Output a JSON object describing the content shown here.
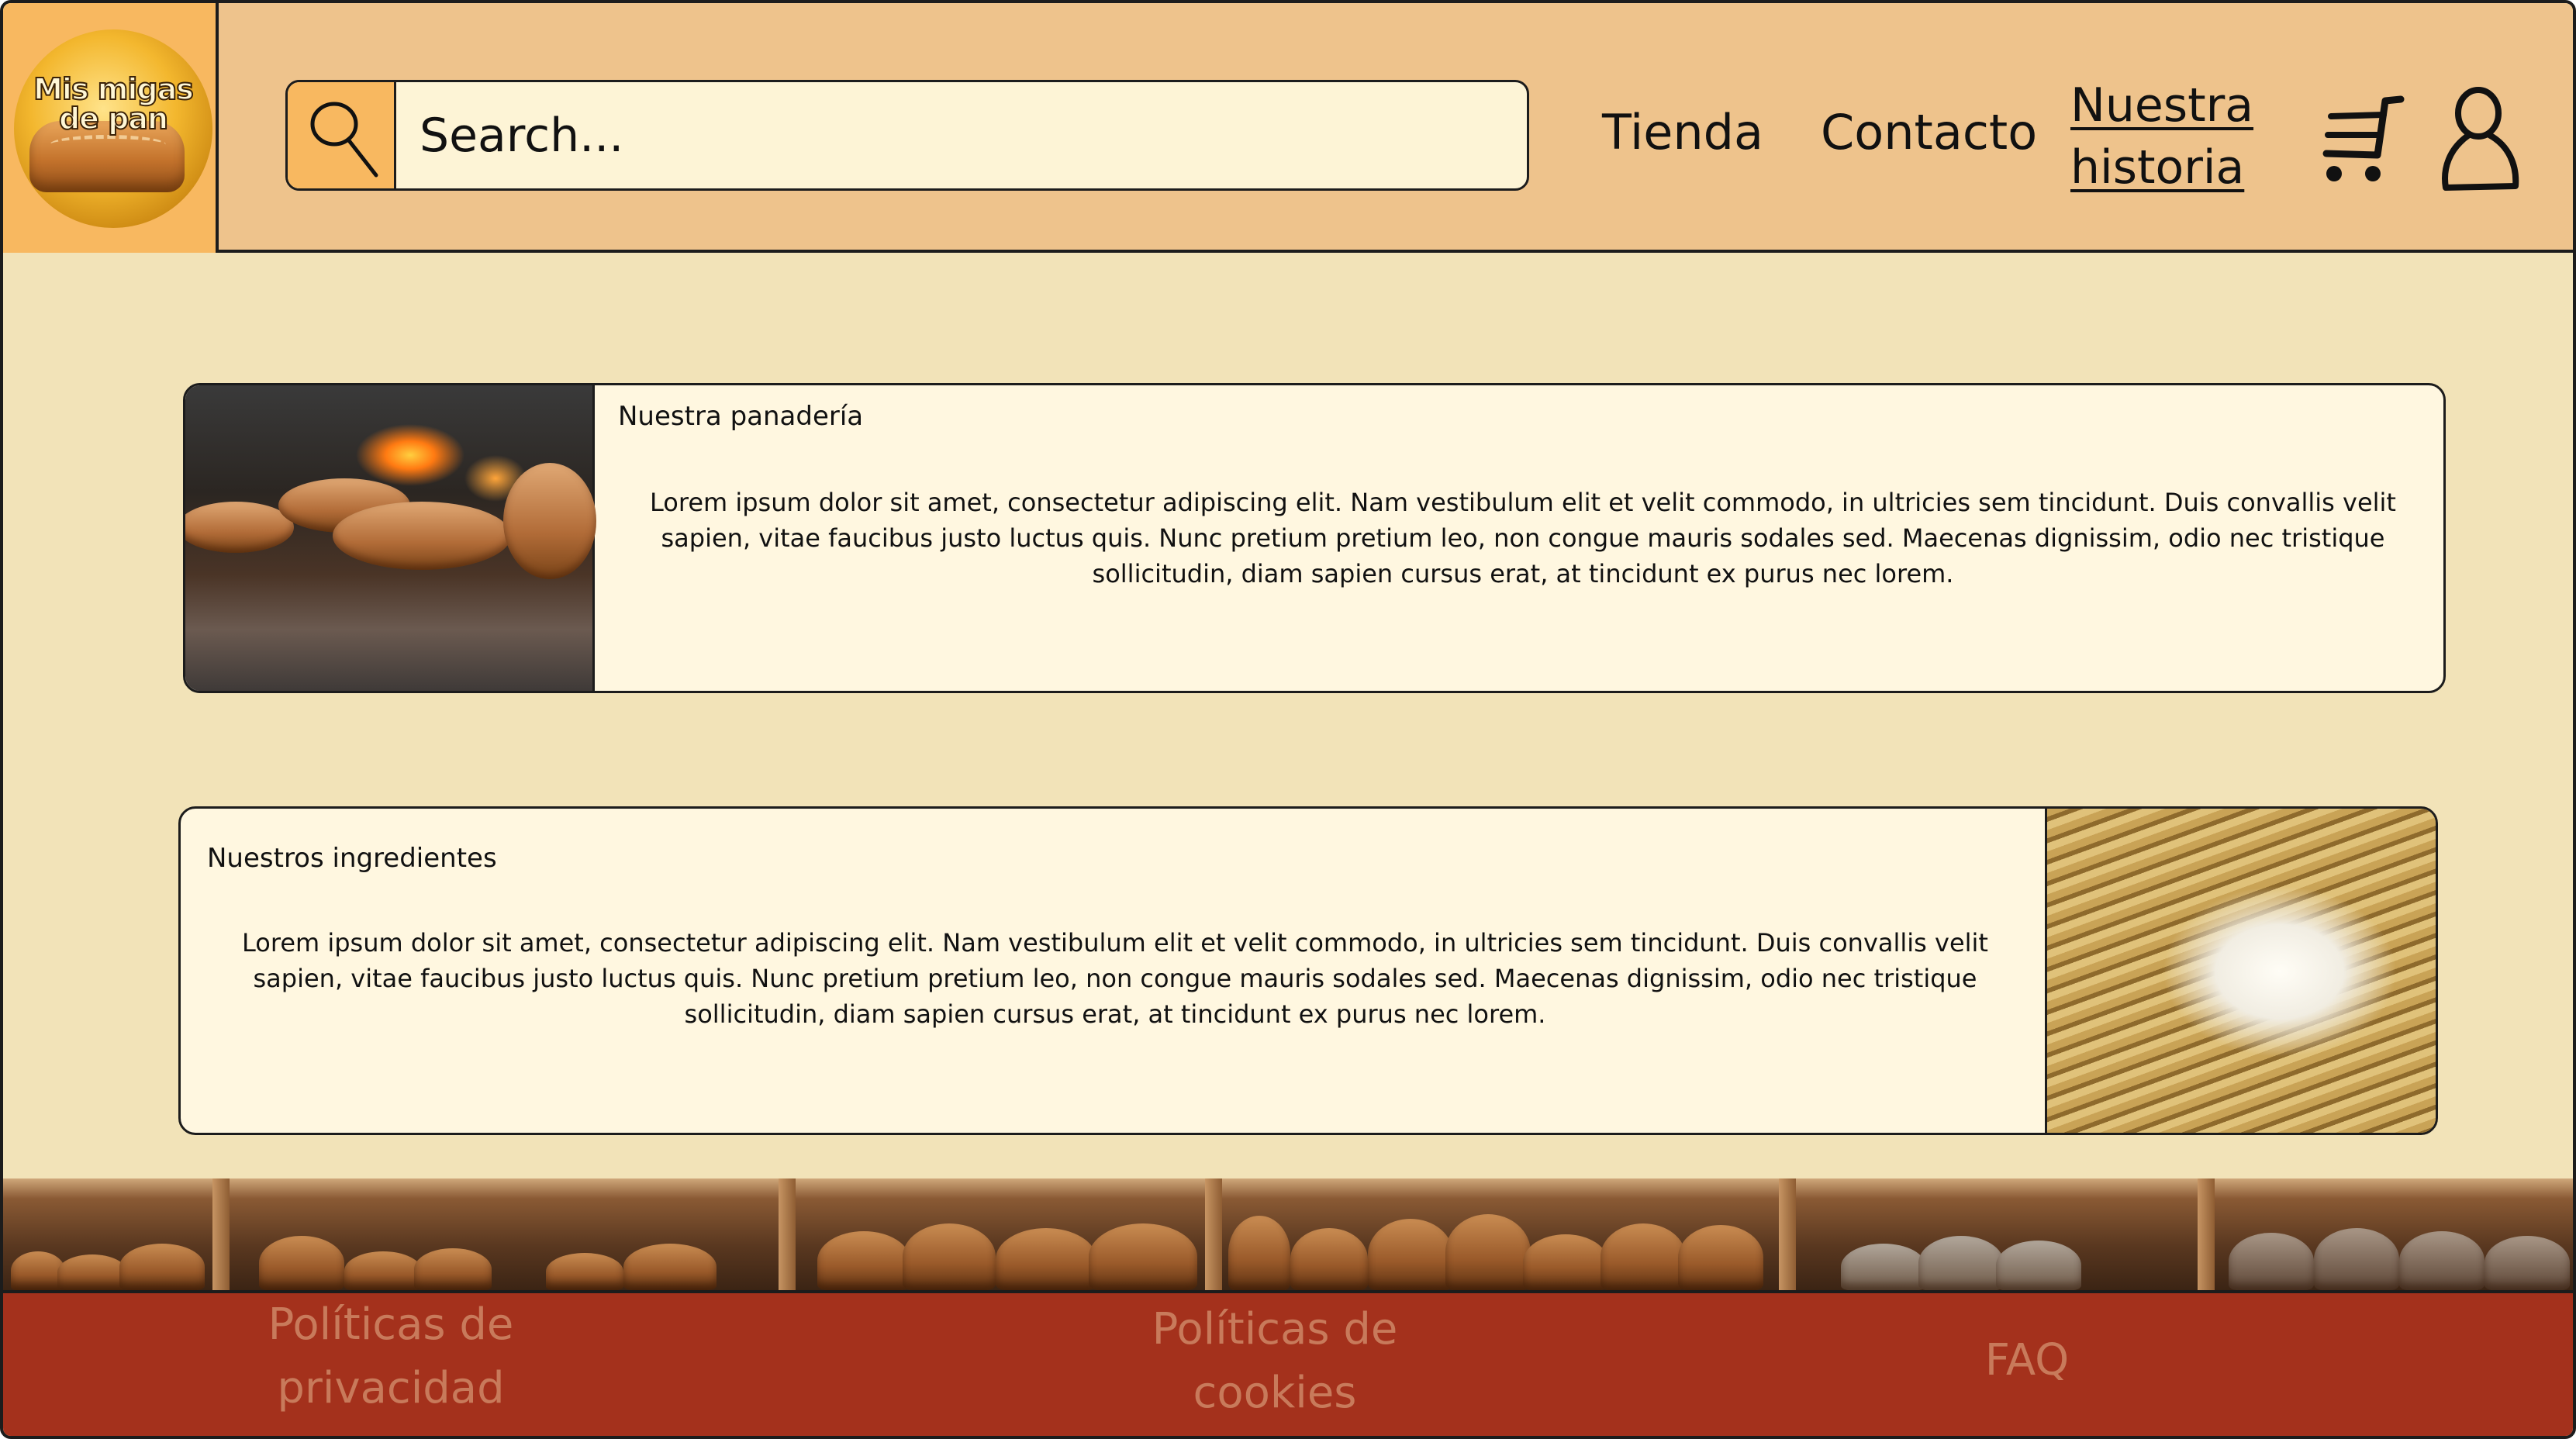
{
  "logo": {
    "text": "Mis migas de pan"
  },
  "search": {
    "placeholder": "Search...",
    "value": ""
  },
  "nav": {
    "shop": "Tienda",
    "contact": "Contacto",
    "history": "Nuestra historia"
  },
  "icons": {
    "search": "search-icon",
    "cart": "cart-icon",
    "user": "user-icon"
  },
  "sections": [
    {
      "title": "Nuestra panadería",
      "body": "Lorem ipsum dolor sit amet, consectetur adipiscing elit. Nam vestibulum elit et velit commodo, in ultricies sem tincidunt. Duis convallis velit sapien, vitae faucibus justo luctus quis. Nunc pretium pretium leo, non congue mauris sodales sed. Maecenas dignissim, odio nec tristique sollicitudin, diam sapien cursus erat, at tincidunt ex purus nec lorem."
    },
    {
      "title": "Nuestros ingredientes",
      "body": "Lorem ipsum dolor sit amet, consectetur adipiscing elit. Nam vestibulum elit et velit commodo, in ultricies sem tincidunt. Duis convallis velit sapien, vitae faucibus justo luctus quis. Nunc pretium pretium leo, non congue mauris sodales sed. Maecenas dignissim, odio nec tristique sollicitudin, diam sapien cursus erat, at tincidunt ex purus nec lorem."
    }
  ],
  "footer": {
    "privacy": "Políticas de privacidad",
    "cookies": "Políticas de cookies",
    "faq": "FAQ"
  },
  "colors": {
    "header_bg": "#eec38c",
    "accent_orange": "#f8b860",
    "page_bg": "#f2e3b8",
    "card_bg": "#fff7e0",
    "footer_bg": "#a4311c",
    "footer_text": "#c87a5b"
  }
}
